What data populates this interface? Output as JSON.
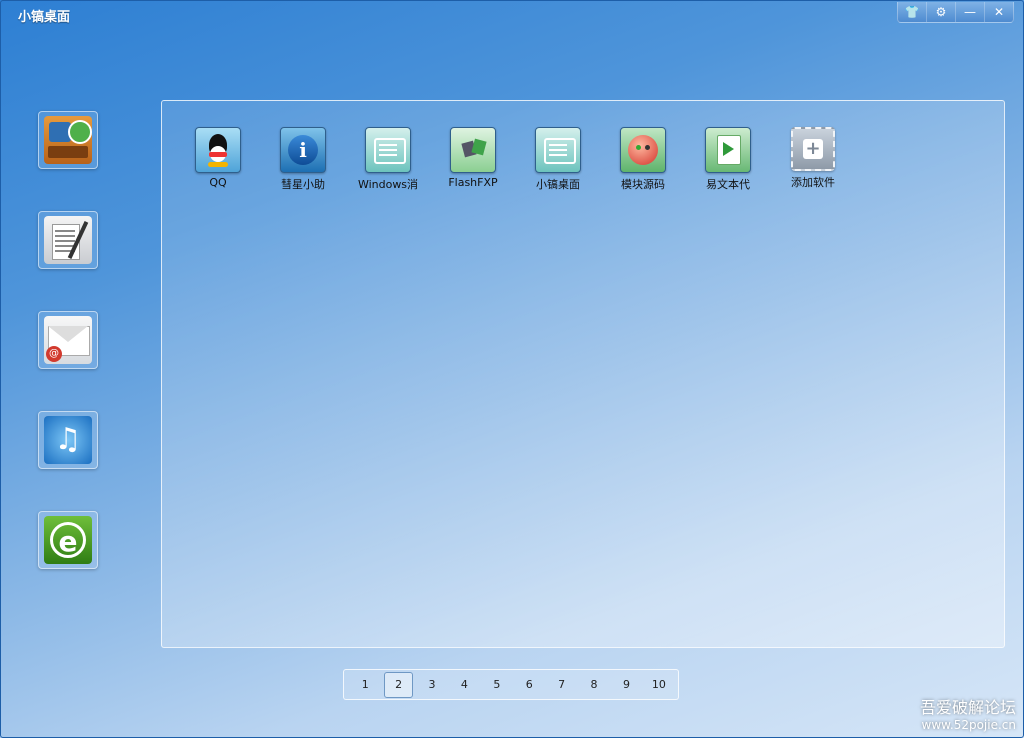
{
  "window": {
    "title": "小镐桌面",
    "controls": [
      {
        "name": "skin-button",
        "glyph": "👕"
      },
      {
        "name": "settings-button",
        "glyph": "⚙"
      },
      {
        "name": "minimize-button",
        "glyph": "—"
      },
      {
        "name": "close-button",
        "glyph": "✕"
      }
    ]
  },
  "sidebar": {
    "items": [
      {
        "name": "calendar-apps-icon"
      },
      {
        "name": "document-pen-icon"
      },
      {
        "name": "mail-icon"
      },
      {
        "name": "music-note-icon"
      },
      {
        "name": "green-browser-icon"
      }
    ]
  },
  "apps": [
    {
      "label": "QQ",
      "icon": "qq-penguin-icon"
    },
    {
      "label": "彗星小助",
      "icon": "info-icon"
    },
    {
      "label": "Windows消",
      "icon": "windows-tool-icon"
    },
    {
      "label": "FlashFXP",
      "icon": "flashfxp-icon"
    },
    {
      "label": "小镐桌面",
      "icon": "desktop-app-icon"
    },
    {
      "label": "模块源码",
      "icon": "module-source-icon"
    },
    {
      "label": "易文本代",
      "icon": "text-proxy-icon"
    },
    {
      "label": "添加软件",
      "icon": "add-software-icon"
    }
  ],
  "pager": {
    "pages": [
      "1",
      "2",
      "3",
      "4",
      "5",
      "6",
      "7",
      "8",
      "9",
      "10"
    ],
    "current": "2"
  },
  "watermark": {
    "line1": "吾爱破解论坛",
    "line2": "www.52pojie.cn"
  }
}
